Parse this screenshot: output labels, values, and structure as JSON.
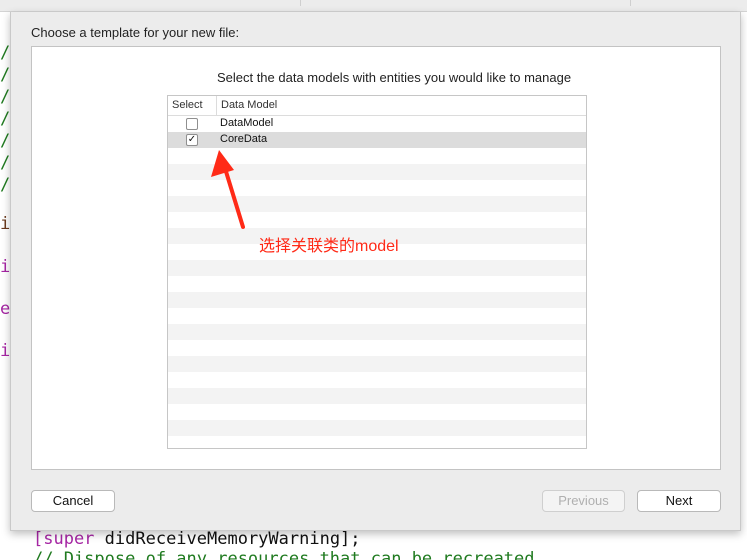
{
  "dialog": {
    "title": "Choose a template for your new file:",
    "heading": "Select the data models with entities you would like to manage"
  },
  "table": {
    "columns": [
      "Select",
      "Data Model"
    ],
    "rows": [
      {
        "label": "DataModel",
        "checked": false,
        "check_glyph": ""
      },
      {
        "label": "CoreData",
        "checked": true,
        "check_glyph": "✓"
      }
    ]
  },
  "annotation": {
    "text": "选择关联类的model",
    "color": "#ff2a17"
  },
  "buttons": {
    "cancel": "Cancel",
    "previous": "Previous",
    "next": "Next"
  },
  "background_code": {
    "line1_kw": "[super",
    "line1_rest": " didReceiveMemoryWarning];",
    "line2": "// Dispose of any resources that can be recreated."
  }
}
